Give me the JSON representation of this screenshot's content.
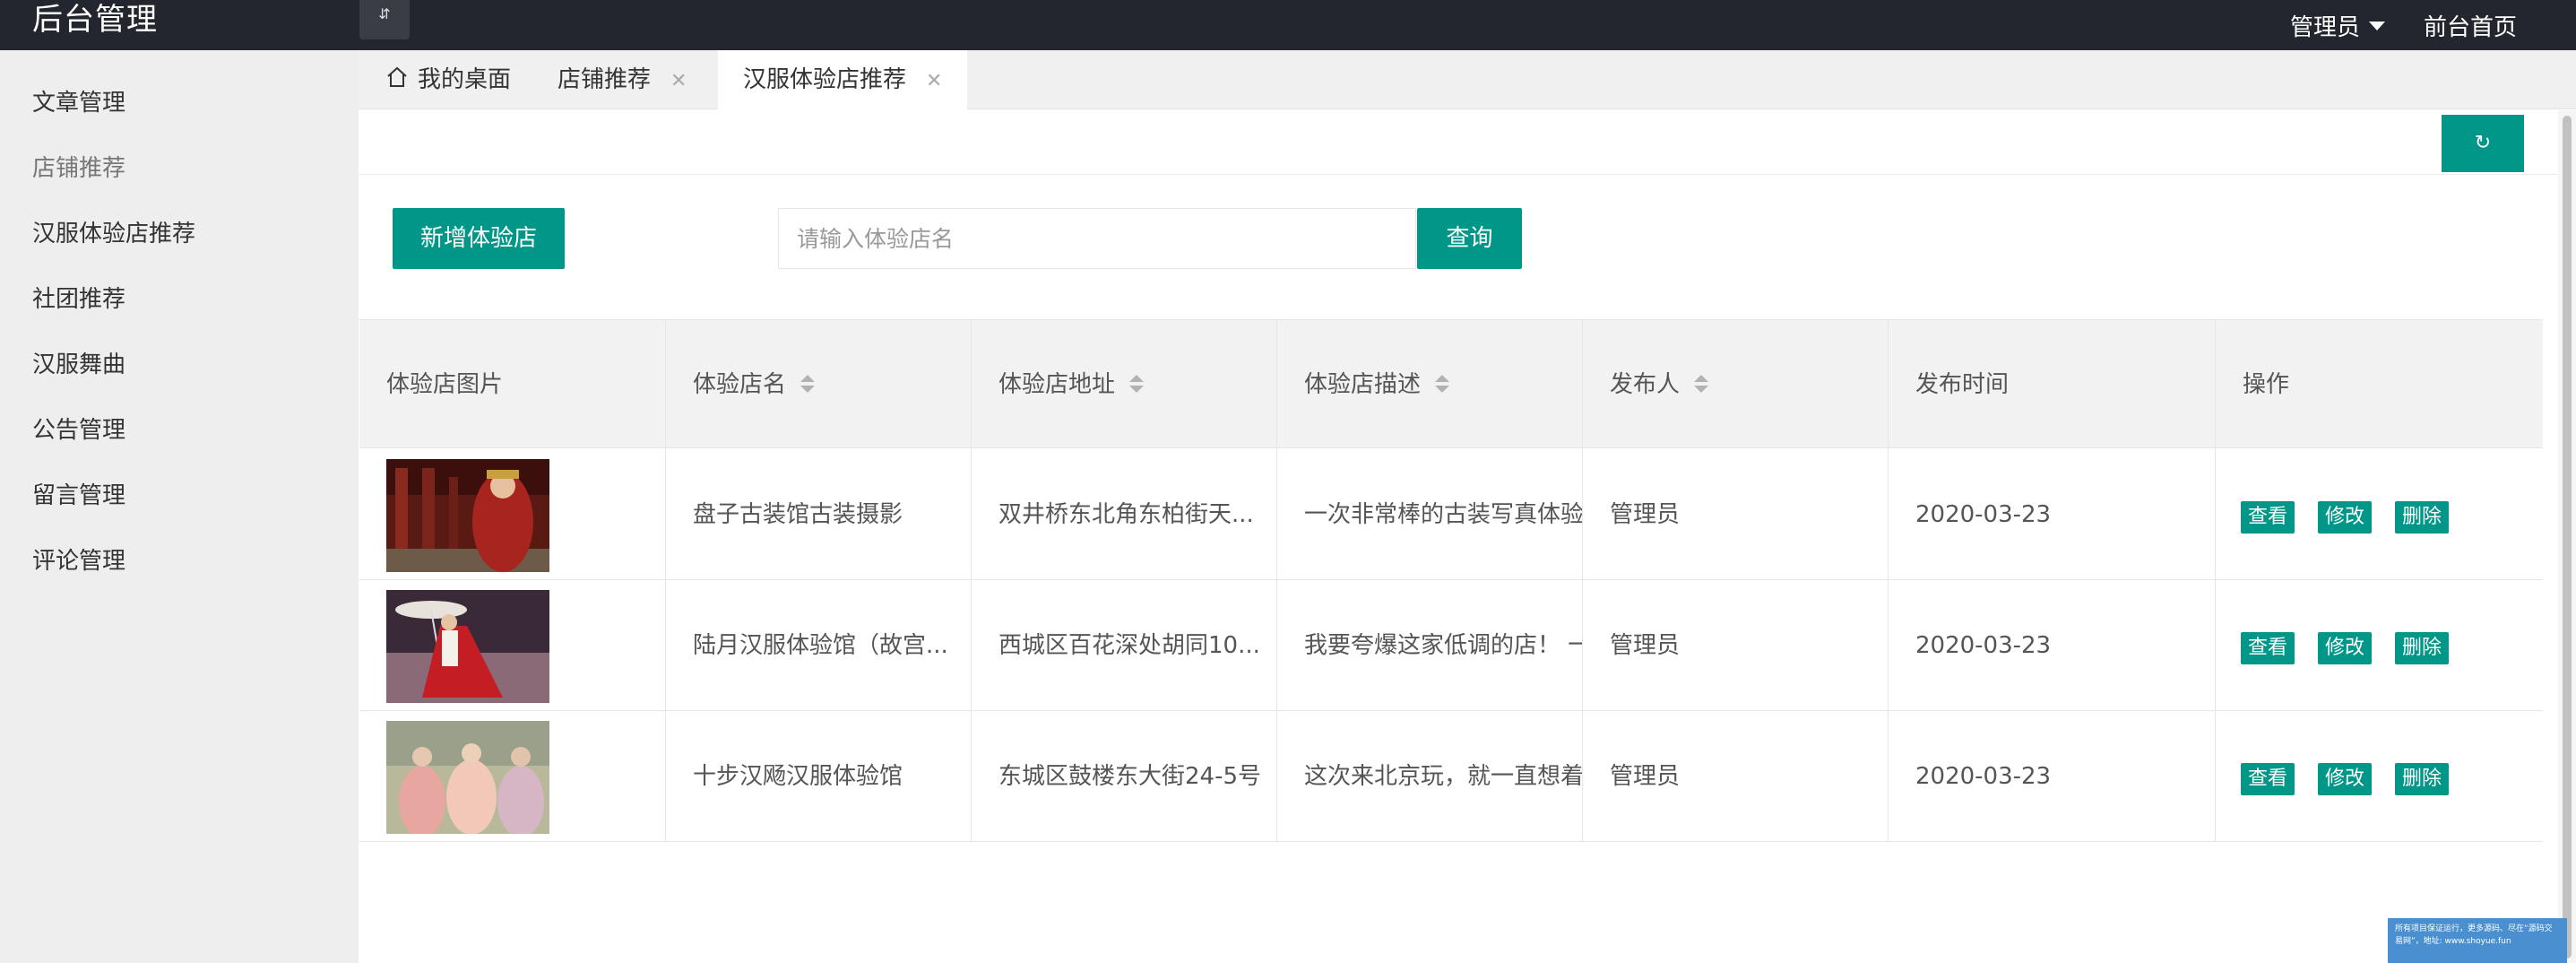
{
  "app": {
    "title": "后台管理",
    "toggle_glyph": "⇵"
  },
  "header": {
    "admin_label": "管理员",
    "front_link": "前台首页"
  },
  "sidebar": {
    "items": [
      {
        "label": "文章管理"
      },
      {
        "label": "店铺推荐"
      },
      {
        "label": "汉服体验店推荐"
      },
      {
        "label": "社团推荐"
      },
      {
        "label": "汉服舞曲"
      },
      {
        "label": "公告管理"
      },
      {
        "label": "留言管理"
      },
      {
        "label": "评论管理"
      }
    ]
  },
  "tabs": [
    {
      "label": "我的桌面",
      "icon": "home-icon"
    },
    {
      "label": "店铺推荐",
      "close": "✕"
    },
    {
      "label": "汉服体验店推荐",
      "close": "✕",
      "active": true
    }
  ],
  "toolbar": {
    "refresh_glyph": "↻",
    "add_label": "新增体验店",
    "search_placeholder": "请输入体验店名",
    "query_label": "查询"
  },
  "table": {
    "headers": [
      "体验店图片",
      "体验店名",
      "体验店地址",
      "体验店描述",
      "发布人",
      "发布时间",
      "操作"
    ],
    "rows": [
      {
        "name": "盘子古装馆古装摄影",
        "address": "双井桥东北角东柏街天...",
        "desc": "一次非常棒的古装写真体验!",
        "publisher": "管理员",
        "date": "2020-03-23"
      },
      {
        "name": "陆月汉服体验馆（故宫...",
        "address": "西城区百花深处胡同10...",
        "desc": "我要夸爆这家低调的店！ 一",
        "publisher": "管理员",
        "date": "2020-03-23"
      },
      {
        "name": "十步汉飏汉服体验馆",
        "address": "东城区鼓楼东大街24-5号",
        "desc": "这次来北京玩，就一直想着",
        "publisher": "管理员",
        "date": "2020-03-23"
      }
    ],
    "actions": {
      "view": "查看",
      "edit": "修改",
      "delete": "删除"
    }
  },
  "watermark": "所有项目保证运行，更多源码、尽在“源码交易网”，地址: www.shoyue.fun",
  "colors": {
    "accent": "#009688",
    "topbar": "#23262e",
    "sidebar": "#eeeeee"
  }
}
